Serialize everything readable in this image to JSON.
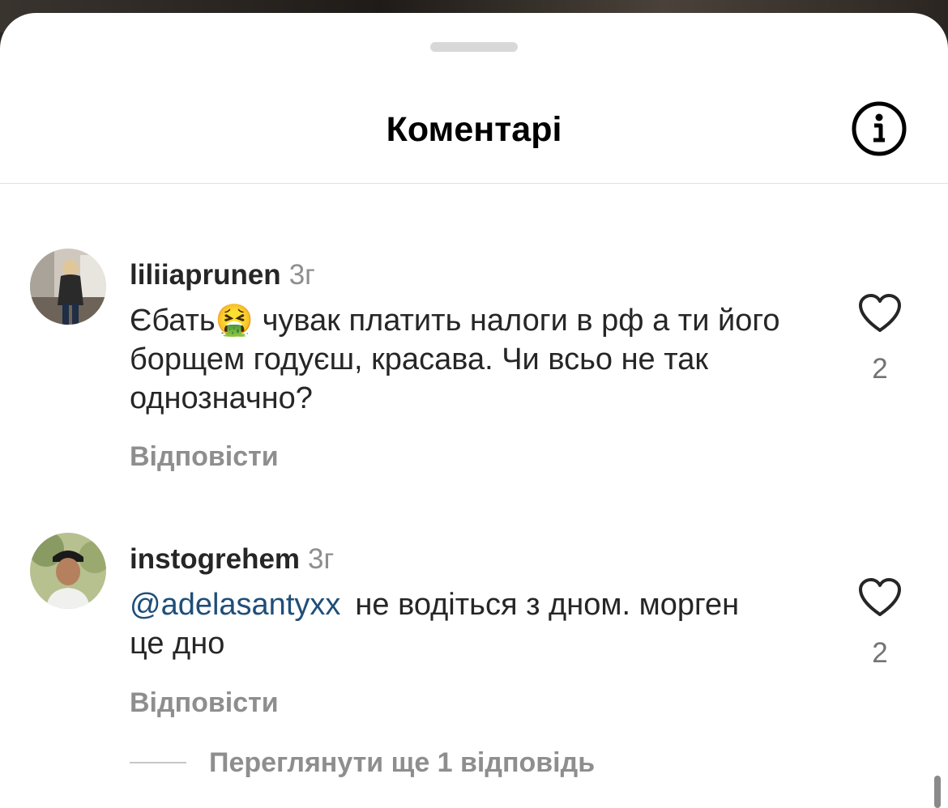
{
  "sheet": {
    "title": "Коментарі",
    "info_icon": "info-circle-icon"
  },
  "comments": [
    {
      "username": "liliiaprunen",
      "time": "3г",
      "text_before_emoji": "Єбать",
      "emoji": "🤮",
      "text": " чувак платить налоги в рф а ти його борщем годуєш, красава. Чи всьо не так однозначно?",
      "reply_label": "Відповісти",
      "like_count": "2",
      "like_icon": "heart-outline-icon"
    },
    {
      "username": "instogrehem",
      "time": "3г",
      "mention": "@adelasantyxx",
      "text": "не водіться  з дном. морген це дно",
      "reply_label": "Відповісти",
      "like_count": "2",
      "like_icon": "heart-outline-icon"
    }
  ],
  "view_replies_label": "Переглянути ще 1 відповідь"
}
